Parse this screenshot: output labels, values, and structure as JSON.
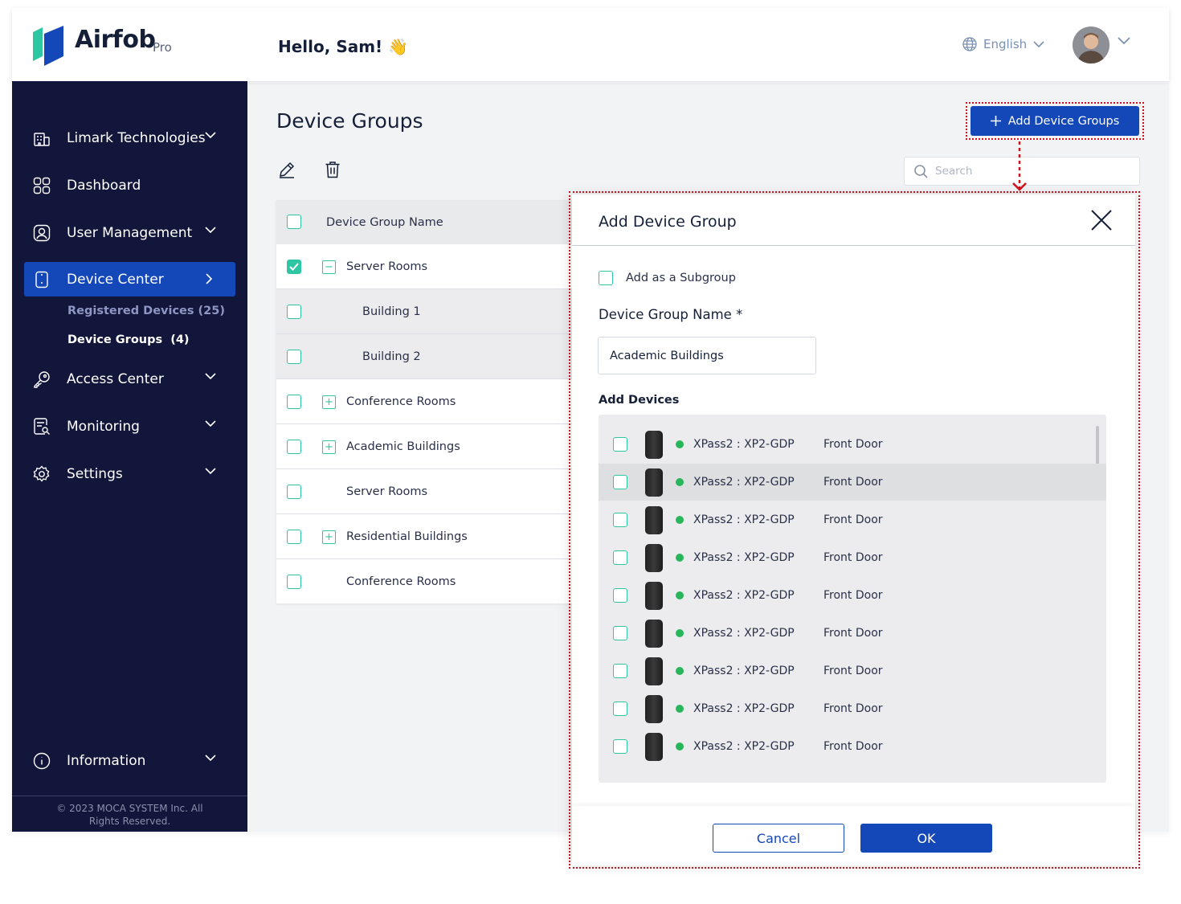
{
  "app": {
    "name": "Airfob",
    "edition": "Pro"
  },
  "header": {
    "greeting": "Hello, Sam! 👋",
    "language": "English"
  },
  "sidebar": {
    "items": [
      {
        "label": "Limark Technologies"
      },
      {
        "label": "Dashboard"
      },
      {
        "label": "User Management"
      },
      {
        "label": "Device Center"
      },
      {
        "label": "Access Center"
      },
      {
        "label": "Monitoring"
      },
      {
        "label": "Settings"
      },
      {
        "label": "Information"
      }
    ],
    "subitems": [
      {
        "label": "Registered Devices (25)"
      },
      {
        "label": "Device Groups  (4)"
      }
    ],
    "footer": "© 2023 MOCA SYSTEM Inc. All Rights Reserved."
  },
  "main": {
    "title": "Device Groups",
    "add_button": "Add Device Groups",
    "search_placeholder": "Search",
    "table_header": "Device Group Name",
    "rows": [
      {
        "name": "Server Rooms",
        "checked": true,
        "expander": "minus"
      },
      {
        "name": "Building 1",
        "checked": false,
        "expander": "none"
      },
      {
        "name": "Building 2",
        "checked": false,
        "expander": "none"
      },
      {
        "name": "Conference Rooms",
        "checked": false,
        "expander": "plus"
      },
      {
        "name": "Academic Buildings",
        "checked": false,
        "expander": "plus"
      },
      {
        "name": "Server Rooms",
        "checked": false,
        "expander": "none"
      },
      {
        "name": "Residential Buildings",
        "checked": false,
        "expander": "plus"
      },
      {
        "name": "Conference Rooms",
        "checked": false,
        "expander": "none"
      }
    ]
  },
  "modal": {
    "title": "Add Device Group",
    "subgroup_label": "Add as a Subgroup",
    "name_label": "Device Group Name *",
    "name_value": "Academic Buildings",
    "devices_label": "Add Devices",
    "devices": [
      {
        "name": "XPass2 : XP2-GDP",
        "location": "Front Door"
      },
      {
        "name": "XPass2 : XP2-GDP",
        "location": "Front Door"
      },
      {
        "name": "XPass2 : XP2-GDP",
        "location": "Front Door"
      },
      {
        "name": "XPass2 : XP2-GDP",
        "location": "Front Door"
      },
      {
        "name": "XPass2 : XP2-GDP",
        "location": "Front Door"
      },
      {
        "name": "XPass2 : XP2-GDP",
        "location": "Front Door"
      },
      {
        "name": "XPass2 : XP2-GDP",
        "location": "Front Door"
      },
      {
        "name": "XPass2 : XP2-GDP",
        "location": "Front Door"
      },
      {
        "name": "XPass2 : XP2-GDP",
        "location": "Front Door"
      }
    ],
    "cancel": "Cancel",
    "ok": "OK"
  },
  "colors": {
    "primary": "#1447b8",
    "sidebar": "#12163a",
    "accent": "#2fc7a3",
    "status_online": "#27b65a",
    "annotation": "#d0121b"
  }
}
